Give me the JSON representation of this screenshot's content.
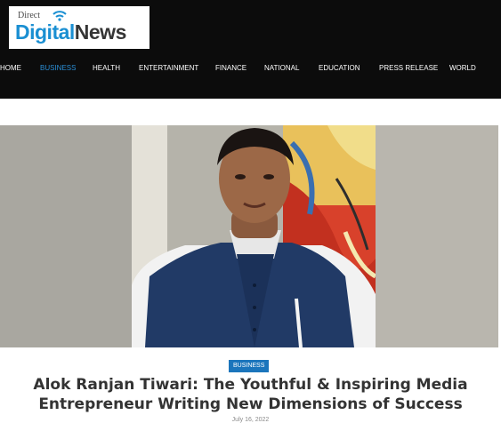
{
  "logo": {
    "top_text": "Direct",
    "word_digital": "Digital",
    "word_news": "News"
  },
  "nav": {
    "items": [
      {
        "label": "HOME"
      },
      {
        "label": "BUSINESS",
        "active": true
      },
      {
        "label": "HEALTH"
      },
      {
        "label": "ENTERTAINMENT"
      },
      {
        "label": "FINANCE"
      },
      {
        "label": "NATIONAL"
      },
      {
        "label": "EDUCATION"
      },
      {
        "label": "PRESS RELEASE"
      },
      {
        "label": "WORLD"
      }
    ]
  },
  "article": {
    "category": "BUSINESS",
    "title": "Alok Ranjan Tiwari: The Youthful & Inspiring Media Entrepreneur Writing New Dimensions of Success",
    "date": "July 16, 2022"
  },
  "colors": {
    "header_bg": "#0c0c0c",
    "accent": "#1b75bc",
    "nav_active": "#2b8fd6",
    "logo_blue": "#1a8fd2"
  }
}
